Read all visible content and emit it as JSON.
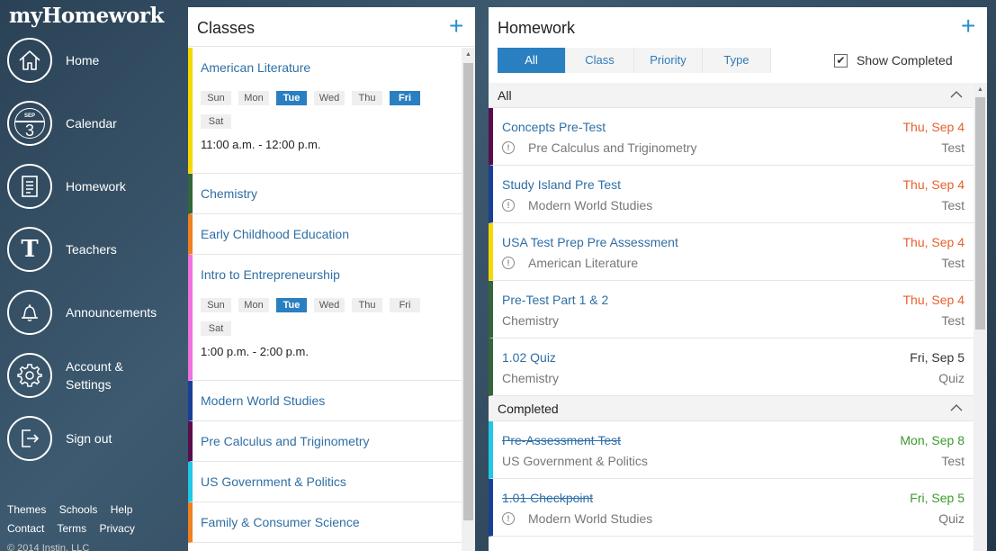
{
  "app": {
    "title": "myHomework"
  },
  "sidebar": {
    "items": [
      {
        "label": "Home",
        "icon": "home-icon"
      },
      {
        "label": "Calendar",
        "icon": "calendar-icon",
        "cal_month": "SEP",
        "cal_day": "3"
      },
      {
        "label": "Homework",
        "icon": "document-icon"
      },
      {
        "label": "Teachers",
        "icon": "teacher-icon",
        "glyph": "T"
      },
      {
        "label": "Announcements",
        "icon": "bell-icon"
      },
      {
        "label": "Account &",
        "label2": "Settings",
        "icon": "gear-icon"
      },
      {
        "label": "Sign out",
        "icon": "sign-out-icon"
      }
    ],
    "footer": [
      "Themes",
      "Schools",
      "Help",
      "Contact",
      "Terms",
      "Privacy"
    ],
    "copyright": "© 2014 Instin, LLC"
  },
  "classes": {
    "title": "Classes",
    "add_label": "+",
    "days": [
      "Sun",
      "Mon",
      "Tue",
      "Wed",
      "Thu",
      "Fri",
      "Sat"
    ],
    "items": [
      {
        "name": "American Literature",
        "color": "#f5d800",
        "days_on": [
          "Tue",
          "Fri"
        ],
        "time": "11:00 a.m. - 12:00 p.m."
      },
      {
        "name": "Chemistry",
        "color": "#35653a"
      },
      {
        "name": "Early Childhood Education",
        "color": "#f08020"
      },
      {
        "name": "Intro to Entrepreneurship",
        "color": "#f070e0",
        "days_on": [
          "Tue"
        ],
        "time": "1:00 p.m. - 2:00 p.m."
      },
      {
        "name": "Modern World Studies",
        "color": "#1a3f96"
      },
      {
        "name": "Pre Calculus and Triginometry",
        "color": "#5a0d4a"
      },
      {
        "name": "US Government & Politics",
        "color": "#20c8e8"
      },
      {
        "name": "Family & Consumer Science",
        "color": "#f08020"
      }
    ]
  },
  "homework": {
    "title": "Homework",
    "add_label": "+",
    "filters": [
      "All",
      "Class",
      "Priority",
      "Type"
    ],
    "active_filter": "All",
    "show_completed_label": "Show Completed",
    "show_completed_checked": true,
    "check_glyph": "✔",
    "groups": [
      {
        "label": "All",
        "items": [
          {
            "title": "Concepts Pre-Test",
            "class": "Pre Calculus and Triginometry",
            "date": "Thu, Sep 4",
            "type": "Test",
            "color": "#5a0d4a",
            "date_color": "#e8602c",
            "priority": true
          },
          {
            "title": "Study Island Pre Test",
            "class": "Modern World Studies",
            "date": "Thu, Sep 4",
            "type": "Test",
            "color": "#1a3f96",
            "date_color": "#e8602c",
            "priority": true
          },
          {
            "title": "USA Test Prep Pre Assessment",
            "class": "American Literature",
            "date": "Thu, Sep 4",
            "type": "Test",
            "color": "#f5d800",
            "date_color": "#e8602c",
            "priority": true
          },
          {
            "title": "Pre-Test Part 1 & 2",
            "class": "Chemistry",
            "date": "Thu, Sep 4",
            "type": "Test",
            "color": "#35653a",
            "date_color": "#e8602c",
            "priority": false
          },
          {
            "title": "1.02 Quiz",
            "class": "Chemistry",
            "date": "Fri, Sep 5",
            "type": "Quiz",
            "color": "#35653a",
            "date_color": "#333333",
            "priority": false
          }
        ]
      },
      {
        "label": "Completed",
        "items": [
          {
            "title": "Pre-Assessment Test",
            "class": "US Government & Politics",
            "date": "Mon, Sep 8",
            "type": "Test",
            "color": "#20c8e8",
            "date_color": "#3c9a2e",
            "priority": false,
            "done": true
          },
          {
            "title": "1.01 Checkpoint",
            "class": "Modern World Studies",
            "date": "Fri, Sep 5",
            "type": "Quiz",
            "color": "#1a3f96",
            "date_color": "#3c9a2e",
            "priority": true,
            "done": true
          }
        ]
      }
    ],
    "priority_glyph": "!"
  }
}
